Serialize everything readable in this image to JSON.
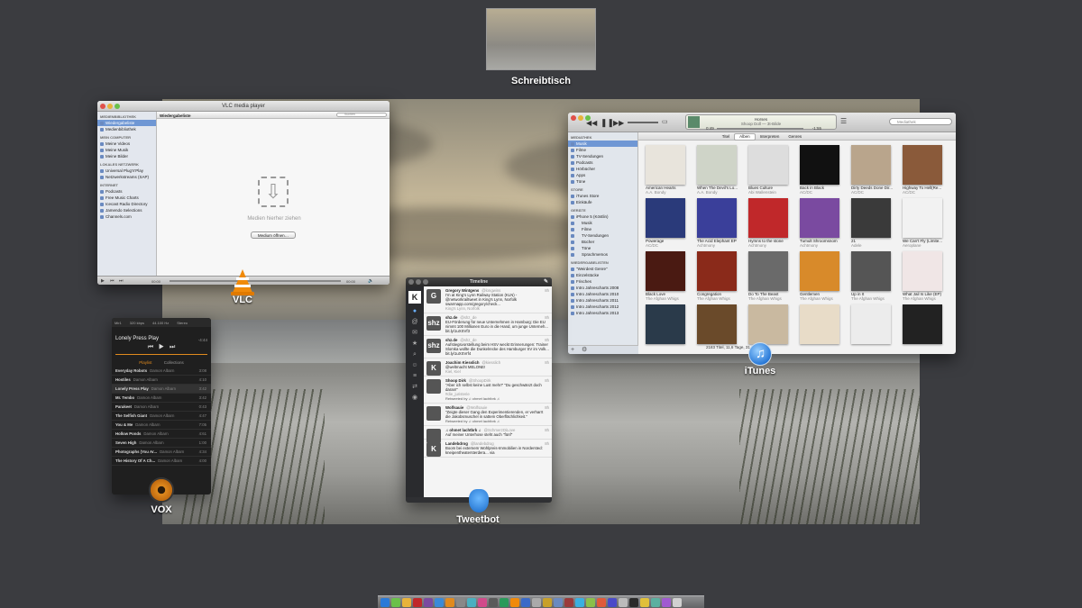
{
  "space": {
    "label": "Schreibtisch"
  },
  "apps": {
    "vlc": "VLC",
    "itunes": "iTunes",
    "tweetbot": "Tweetbot",
    "vox": "VOX"
  },
  "vlc": {
    "title": "VLC media player",
    "sections": [
      {
        "head": "MEDIENBIBLIOTHEK",
        "items": [
          "Wiedergabeliste",
          "Medienbibliothek"
        ]
      },
      {
        "head": "MEIN COMPUTER",
        "items": [
          "Meine Videos",
          "Meine Musik",
          "Meine Bilder"
        ]
      },
      {
        "head": "LOKALES NETZWERK",
        "items": [
          "Universal Plug'n'Play",
          "Netzwerkstreams (SAP)"
        ]
      },
      {
        "head": "INTERNET",
        "items": [
          "Podcasts",
          "Free Music Charts",
          "Icecast Radio Directory",
          "Jamendo Selections",
          "Channels.com"
        ]
      }
    ],
    "header": "Wiedergabeliste",
    "search_placeholder": "Suchen",
    "drop_text": "Medien hierher ziehen",
    "open_button": "Medium öffnen…",
    "time_left": "00:00",
    "time_right": "00:00"
  },
  "itunes": {
    "now_title": "Horses",
    "now_sub": "Shoop Doll — 3t-Bilde",
    "time_elapsed": "0:49",
    "time_left": "-1:55",
    "search_placeholder": "Mediathek",
    "views": [
      "Titel",
      "Alben",
      "Interpreten",
      "Genres"
    ],
    "sidebar": [
      {
        "head": "MEDIATHEK",
        "items": [
          "Musik",
          "Filme",
          "TV-Sendungen",
          "Podcasts",
          "Hörbücher",
          "Apps",
          "Töne"
        ]
      },
      {
        "head": "STORE",
        "items": [
          "iTunes Store",
          "Einkäufe"
        ]
      },
      {
        "head": "GERÄTE",
        "items": [
          "iPhone 5 (Köstlin)",
          "Musik",
          "Filme",
          "TV-Sendungen",
          "Bücher",
          "Töne",
          "Sprachmemos"
        ]
      },
      {
        "head": "WIEDERGABELISTEN",
        "items": [
          "\"Weirdest Genre\"",
          "Einzelstücke",
          "Frisches",
          "Intro Jahrescharts 2008",
          "Intro Jahrescharts 2010",
          "Intro Jahrescharts 2011",
          "Intro Jahrescharts 2012",
          "Intro Jahrescharts 2013"
        ]
      }
    ],
    "albums": [
      {
        "title": "American Hearts",
        "artist": "A.A. Bondy",
        "color": "#e8e4dc"
      },
      {
        "title": "When The Devil's Lo...",
        "artist": "A.A. Bondy",
        "color": "#cfd4c8"
      },
      {
        "title": "Blues Culture",
        "artist": "Abi Wallenstein",
        "color": "#dddddd"
      },
      {
        "title": "Back in Black",
        "artist": "AC/DC",
        "color": "#111111"
      },
      {
        "title": "Dirty Deeds Done Dir...",
        "artist": "AC/DC",
        "color": "#b9a58c"
      },
      {
        "title": "Highway To Hell(Re...",
        "artist": "AC/DC",
        "color": "#8a5a3a"
      },
      {
        "title": "Powerage",
        "artist": "AC/DC",
        "color": "#2a3a7a"
      },
      {
        "title": "The Acid Elephant EP",
        "artist": "Achtmony",
        "color": "#3a3f9a"
      },
      {
        "title": "Hymns to the stone",
        "artist": "Achtmony",
        "color": "#c0282a"
      },
      {
        "title": "Tumult Shroomsnom",
        "artist": "Achtmony",
        "color": "#7a4aa0"
      },
      {
        "title": "21",
        "artist": "Adele",
        "color": "#3a3a3a"
      },
      {
        "title": "We Can't Fly (Limite...",
        "artist": "Aeroplane",
        "color": "#f2f2f2"
      },
      {
        "title": "Black Love",
        "artist": "The Afghan Whigs",
        "color": "#4a1a12"
      },
      {
        "title": "Congregation",
        "artist": "The Afghan Whigs",
        "color": "#8a2a1a"
      },
      {
        "title": "Do To The Beast",
        "artist": "The Afghan Whigs",
        "color": "#6a6a6a"
      },
      {
        "title": "Gentlemen",
        "artist": "The Afghan Whigs",
        "color": "#d88a2a"
      },
      {
        "title": "Up in It",
        "artist": "The Afghan Whigs",
        "color": "#555555"
      },
      {
        "title": "What Jail Is Like (EP)",
        "artist": "The Afghan Whigs",
        "color": "#f0e6e6"
      },
      {
        "title": "",
        "artist": "",
        "color": "#2a3a4a"
      },
      {
        "title": "",
        "artist": "",
        "color": "#6a4a2a"
      },
      {
        "title": "",
        "artist": "",
        "color": "#c9b9a0"
      },
      {
        "title": "",
        "artist": "",
        "color": "#e8dcc8"
      },
      {
        "title": "",
        "artist": "",
        "color": "#ececec"
      },
      {
        "title": "",
        "artist": "",
        "color": "#222222"
      }
    ],
    "status": "2183 Titel, 11,6 Tage, 31,21 GB"
  },
  "tweetbot": {
    "title": "Timeline",
    "tweets": [
      {
        "name": "Gregory Wintgens",
        "handle": "@longwins",
        "time": "8h",
        "text": "I'm at King's Lynn Railway Station (KLN) - @networkrailtweet in King's Lynn, Norfolk swarmapp.com/gregory/check...",
        "meta": "King's Lynn, Norfolk",
        "avatar": "G"
      },
      {
        "name": "shz.de",
        "handle": "@shz_de",
        "time": "8h",
        "text": "EU-Förderung für neue Unternehmen in Hamburg: Die EU nimmt 100 Millionen Euro in die Hand, um junge Unterneh... bit.ly/1uXSVf3",
        "meta": "",
        "avatar": "shz"
      },
      {
        "name": "shz.de",
        "handle": "@shz_de",
        "time": "8h",
        "text": "Aufstiegsvorstellung beim HSV weckt Erinnerungen: Trainer Slomka wollte die Dunkelrecke des Hamburger SV im Volk... bit.ly/1uXSVrf4",
        "meta": "",
        "avatar": "shz"
      },
      {
        "name": "Joachim Kiesslich",
        "handle": "@kiesslich",
        "time": "8h",
        "text": "@weltmacht MELONE!",
        "meta": "Kiel, Kiel",
        "avatar": "K"
      },
      {
        "name": "Shoop Dirk",
        "handle": "@ShoopDirk",
        "time": "8h",
        "text": "\"Aber ich selbst keine Lust mehr!\" \"Du geschwänzt doch daran!\"",
        "meta": "#die_juristerie",
        "rt": "Retweeted by ♫ ohmet lachtbrk ♫",
        "avatar": ""
      },
      {
        "name": "Wolfsauie",
        "handle": "@Wolfsauie",
        "time": "8h",
        "text": "\"Zeigte dieser Gang den Experimentierenden, er verharrt die Jakobsmuschel in sattem Oberflächlichkeit.\"",
        "meta": "",
        "rt": "Retweeted by ♫ ohmet lachtbrk ♫",
        "avatar": ""
      },
      {
        "name": "♫ ohmet lachtbrk ♫",
        "handle": "@SchmerzDiLove",
        "time": "8h",
        "text": "Auf meiner Unterhose steht auch \"fünf\"",
        "meta": "",
        "avatar": ""
      },
      {
        "name": "Landebdrog",
        "handle": "@landebdrog",
        "time": "8h",
        "text": "Boom bei externem Wohlpreis-Immobilien in Nordersted: kneipentheatersterdera... via",
        "meta": "",
        "avatar": "K"
      }
    ]
  },
  "vox": {
    "top": [
      "Mir1",
      "320 kbps",
      "44.100 Hz",
      "Stereo"
    ],
    "now_playing": "Lonely Press Play",
    "now_time": "-4:44",
    "tabs": [
      "Playlist",
      "Collections"
    ],
    "tracks": [
      {
        "title": "Everyday Robots",
        "artist": "Damon Albarn",
        "dur": "3:08"
      },
      {
        "title": "Hostiles",
        "artist": "Damon Albarn",
        "dur": "4:10"
      },
      {
        "title": "Lonely Press Play",
        "artist": "Damon Albarn",
        "dur": "3:42"
      },
      {
        "title": "Mr. Tembo",
        "artist": "Damon Albarn",
        "dur": "3:42"
      },
      {
        "title": "Parakeet",
        "artist": "Damon Albarn",
        "dur": "0:43"
      },
      {
        "title": "The Selfish Giant",
        "artist": "Damon Albarn",
        "dur": "4:47"
      },
      {
        "title": "You & Me",
        "artist": "Damon Albarn",
        "dur": "7:05"
      },
      {
        "title": "Hollow Ponds",
        "artist": "Damon Albarn",
        "dur": "4:61"
      },
      {
        "title": "Seven High",
        "artist": "Damon Albarn",
        "dur": "1:00"
      },
      {
        "title": "Photographs (You Ar...",
        "artist": "Damon Albarn",
        "dur": "4:34"
      },
      {
        "title": "The History Of A Ch...",
        "artist": "Damon Albarn",
        "dur": "4:00"
      }
    ]
  },
  "colors": {
    "accent": "#6f97d4",
    "vox_orange": "#e08a1e",
    "vlc_orange": "#f08a0a",
    "itunes_blue": "#2a7ad8",
    "tweetbot_blue": "#3a8ad8"
  }
}
